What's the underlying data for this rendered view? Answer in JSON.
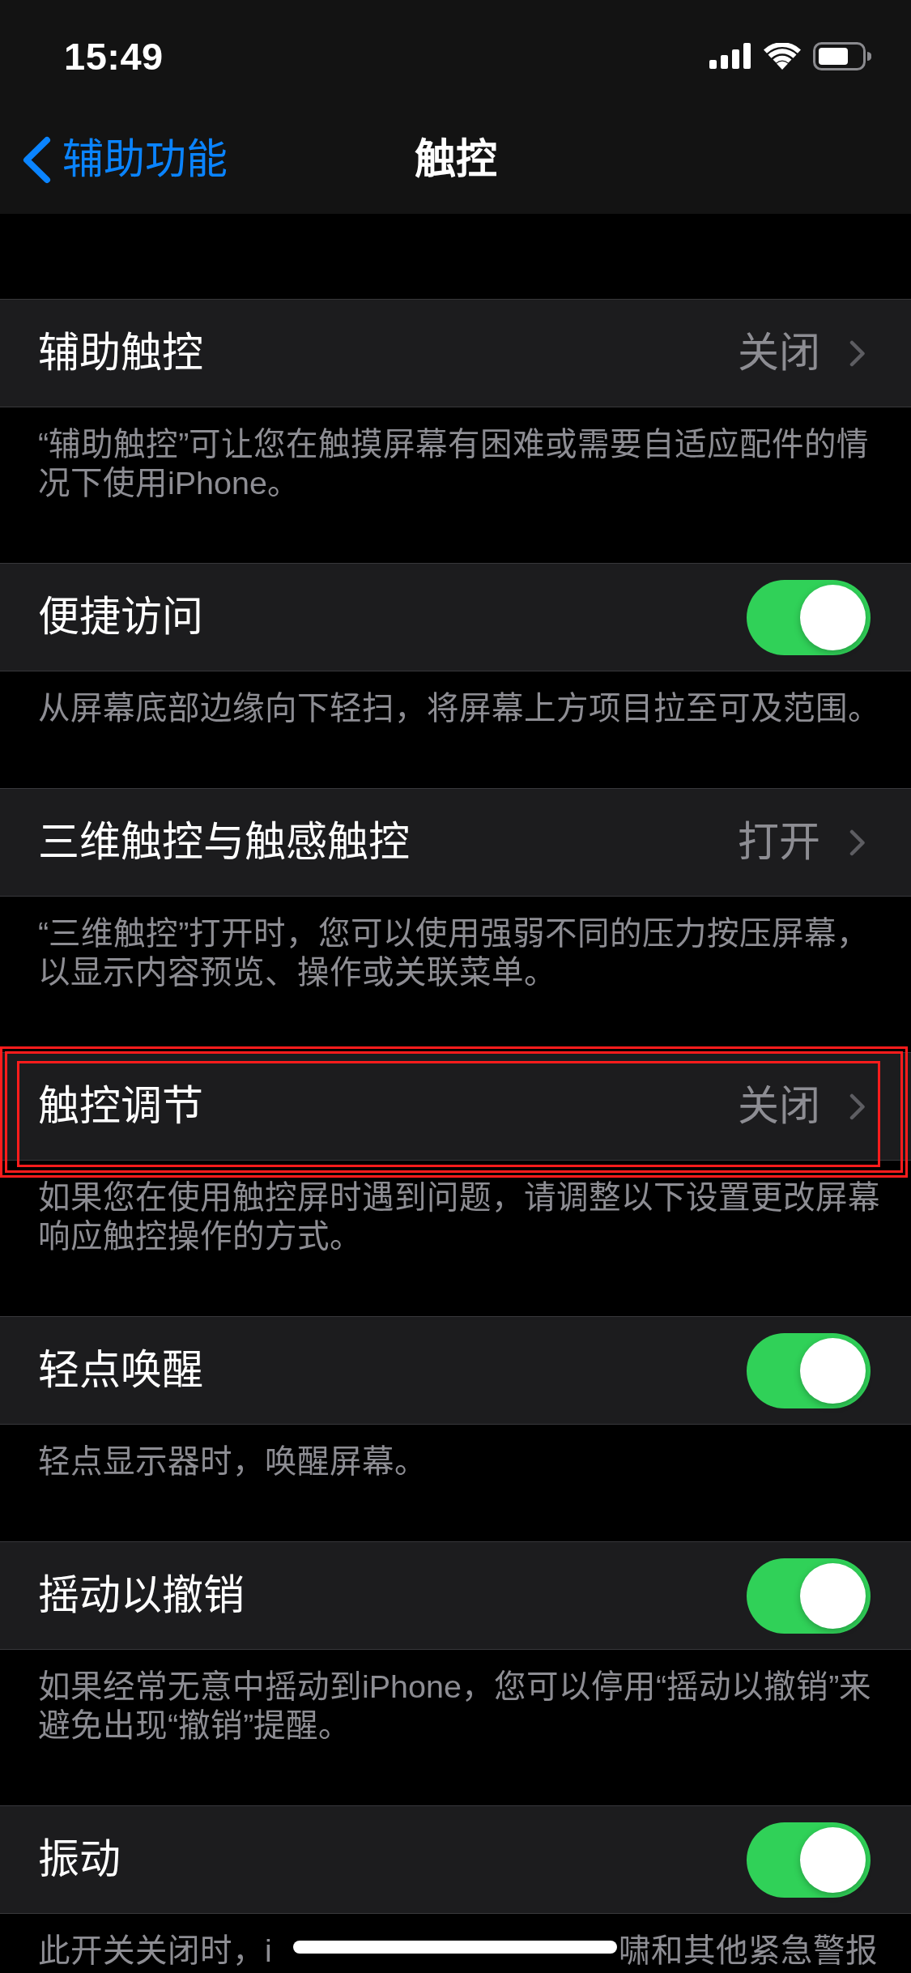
{
  "status_bar": {
    "time": "15:49"
  },
  "nav_bar": {
    "back_label": "辅助功能",
    "title": "触控"
  },
  "sections": [
    {
      "row": {
        "kind": "link",
        "label": "辅助触控",
        "value": "关闭",
        "highlighted": false
      },
      "footer": "“辅助触控”可让您在触摸屏幕有困难或需要自适应配件的情况下使用iPhone。"
    },
    {
      "row": {
        "kind": "toggle",
        "label": "便捷访问",
        "on": true,
        "highlighted": false
      },
      "footer": "从屏幕底部边缘向下轻扫，将屏幕上方项目拉至可及范围。"
    },
    {
      "row": {
        "kind": "link",
        "label": "三维触控与触感触控",
        "value": "打开",
        "highlighted": false
      },
      "footer": "“三维触控”打开时，您可以使用强弱不同的压力按压屏幕，以显示内容预览、操作或关联菜单。"
    },
    {
      "row": {
        "kind": "link",
        "label": "触控调节",
        "value": "关闭",
        "highlighted": true
      },
      "footer": "如果您在使用触控屏时遇到问题，请调整以下设置更改屏幕响应触控操作的方式。"
    },
    {
      "row": {
        "kind": "toggle",
        "label": "轻点唤醒",
        "on": true,
        "highlighted": false
      },
      "footer": "轻点显示器时，唤醒屏幕。"
    },
    {
      "row": {
        "kind": "toggle",
        "label": "摇动以撤销",
        "on": true,
        "highlighted": false
      },
      "footer": "如果经常无意中摇动到iPhone，您可以停用“摇动以撤销”来避免出现“撤销”提醒。"
    },
    {
      "row": {
        "kind": "toggle",
        "label": "振动",
        "on": true,
        "highlighted": false
      },
      "footer_parts": [
        "此开关关闭时，i",
        "啸和其他紧急警报"
      ]
    }
  ]
}
